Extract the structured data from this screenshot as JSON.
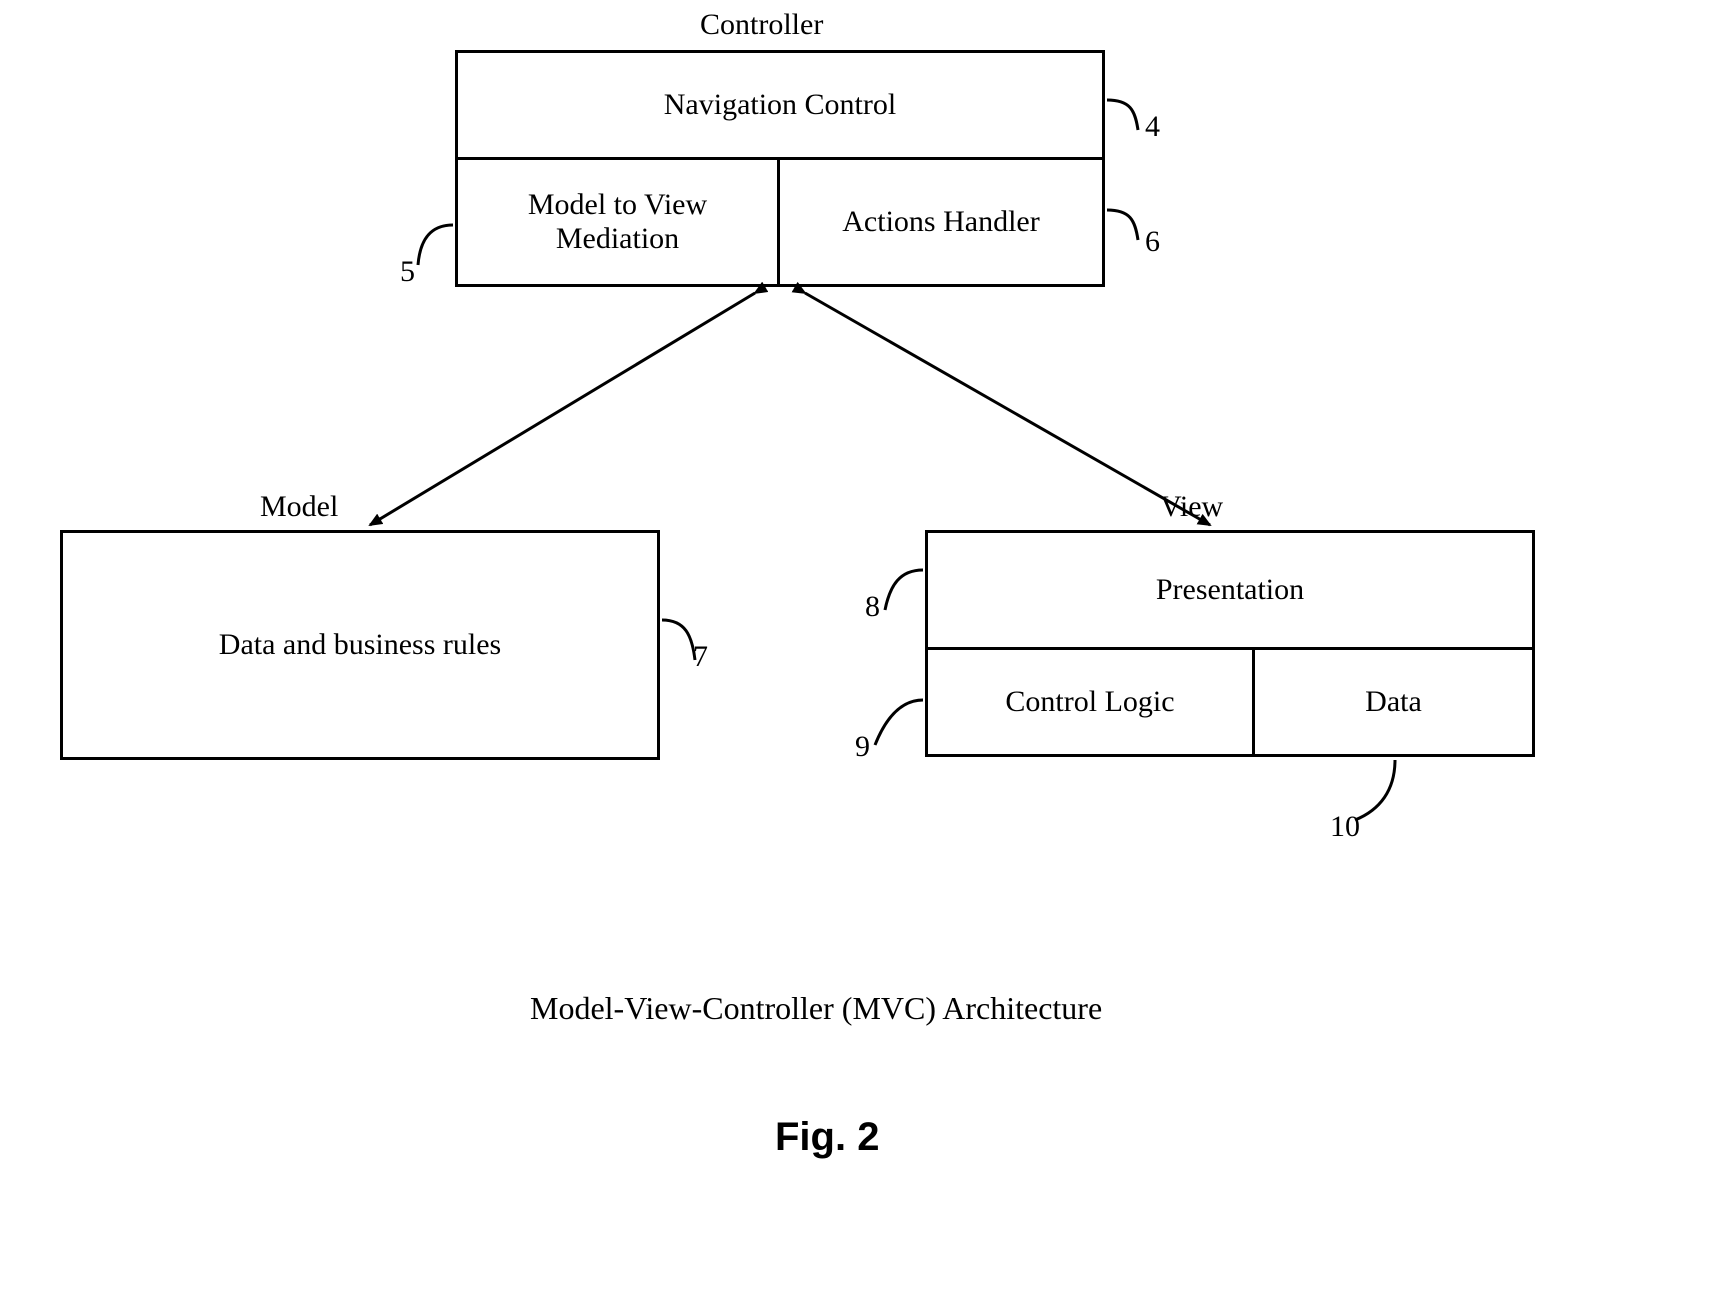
{
  "diagram": {
    "controller": {
      "title": "Controller",
      "nav_control": "Navigation Control",
      "mediation": "Model to View Mediation",
      "actions_handler": "Actions Handler"
    },
    "model": {
      "title": "Model",
      "content": "Data and business rules"
    },
    "view": {
      "title": "View",
      "presentation": "Presentation",
      "control_logic": "Control Logic",
      "data": "Data"
    },
    "callouts": {
      "c4": "4",
      "c5": "5",
      "c6": "6",
      "c7": "7",
      "c8": "8",
      "c9": "9",
      "c10": "10"
    },
    "caption": "Model-View-Controller (MVC) Architecture",
    "figure_label": "Fig. 2"
  }
}
